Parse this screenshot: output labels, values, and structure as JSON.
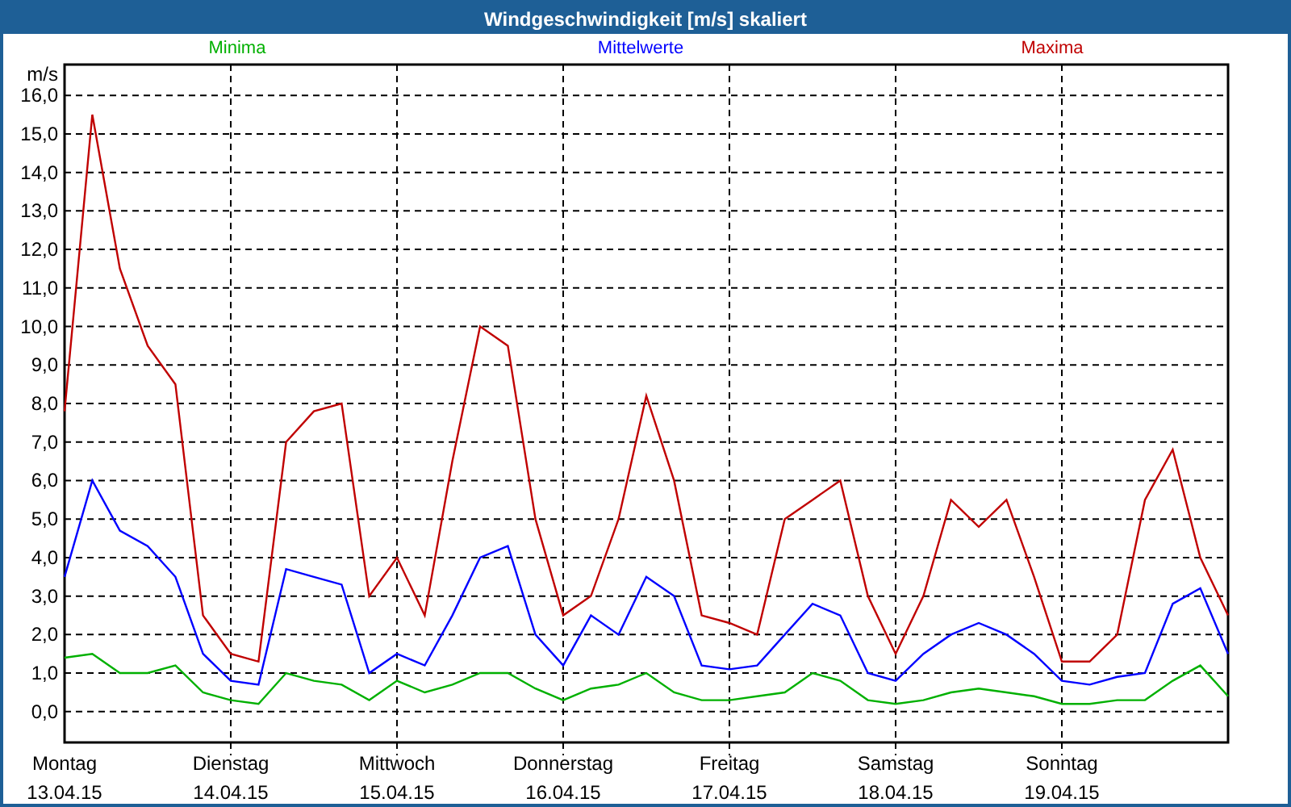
{
  "window": {
    "title": "Windgeschwindigkeit [m/s] skaliert"
  },
  "chart": {
    "chart_data": {
      "type": "line",
      "ylabel": "m/s",
      "categories": [
        "Montag 13.04.15",
        null,
        null,
        null,
        null,
        null,
        "Dienstag 14.04.15",
        null,
        null,
        null,
        null,
        null,
        "Mittwoch 15.04.15",
        null,
        null,
        null,
        null,
        null,
        "Donnerstag 16.04.15",
        null,
        null,
        null,
        null,
        null,
        "Freitag 17.04.15",
        null,
        null,
        null,
        null,
        null,
        "Samstag 18.04.15",
        null,
        null,
        null,
        null,
        null,
        "Sonntag 19.04.15",
        null,
        null,
        null,
        null,
        null,
        null
      ],
      "ylim": [
        -0.8,
        16.8
      ],
      "grid": true,
      "yticks": [
        {
          "value": 0,
          "label": "0,0"
        },
        {
          "value": 1,
          "label": "1,0"
        },
        {
          "value": 2,
          "label": "2,0"
        },
        {
          "value": 3,
          "label": "3,0"
        },
        {
          "value": 4,
          "label": "4,0"
        },
        {
          "value": 5,
          "label": "5,0"
        },
        {
          "value": 6,
          "label": "6,0"
        },
        {
          "value": 7,
          "label": "7,0"
        },
        {
          "value": 8,
          "label": "8,0"
        },
        {
          "value": 9,
          "label": "9,0"
        },
        {
          "value": 10,
          "label": "10,0"
        },
        {
          "value": 11,
          "label": "11,0"
        },
        {
          "value": 12,
          "label": "12,0"
        },
        {
          "value": 13,
          "label": "13,0"
        },
        {
          "value": 14,
          "label": "14,0"
        },
        {
          "value": 15,
          "label": "15,0"
        },
        {
          "value": 16,
          "label": "16,0"
        }
      ],
      "series": [
        {
          "name": "Minima",
          "color": "#00b000",
          "values": [
            1.4,
            1.5,
            1.0,
            1.0,
            1.2,
            0.5,
            0.3,
            0.2,
            1.0,
            0.8,
            0.7,
            0.3,
            0.8,
            0.5,
            0.7,
            1.0,
            1.0,
            0.6,
            0.3,
            0.6,
            0.7,
            1.0,
            0.5,
            0.3,
            0.3,
            0.4,
            0.5,
            1.0,
            0.8,
            0.3,
            0.2,
            0.3,
            0.5,
            0.6,
            0.5,
            0.4,
            0.2,
            0.2,
            0.3,
            0.3,
            0.8,
            1.2,
            0.4
          ]
        },
        {
          "name": "Mittelwerte",
          "color": "#0000ff",
          "values": [
            3.5,
            6.0,
            4.7,
            4.3,
            3.5,
            1.5,
            0.8,
            0.7,
            3.7,
            3.5,
            3.3,
            1.0,
            1.5,
            1.2,
            2.5,
            4.0,
            4.3,
            2.0,
            1.2,
            2.5,
            2.0,
            3.5,
            3.0,
            1.2,
            1.1,
            1.2,
            2.0,
            2.8,
            2.5,
            1.0,
            0.8,
            1.5,
            2.0,
            2.3,
            2.0,
            1.5,
            0.8,
            0.7,
            0.9,
            1.0,
            2.8,
            3.2,
            1.5
          ]
        },
        {
          "name": "Maxima",
          "color": "#c00000",
          "values": [
            7.8,
            15.5,
            11.5,
            9.5,
            8.5,
            2.5,
            1.5,
            1.3,
            7.0,
            7.8,
            8.0,
            3.0,
            4.0,
            2.5,
            6.5,
            10.0,
            9.5,
            5.0,
            2.5,
            3.0,
            5.0,
            8.2,
            6.0,
            2.5,
            2.3,
            2.0,
            5.0,
            5.5,
            6.0,
            3.0,
            1.5,
            3.0,
            5.5,
            4.8,
            5.5,
            3.5,
            1.3,
            1.3,
            2.0,
            5.5,
            6.8,
            4.0,
            2.5
          ]
        }
      ]
    }
  }
}
